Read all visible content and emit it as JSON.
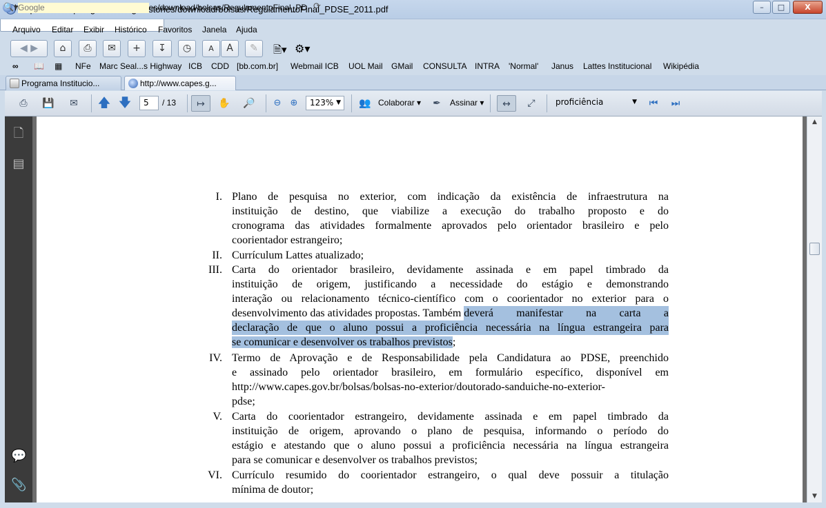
{
  "window": {
    "title": "http://www.capes.gov.br/images/stories/download/bolsas/RegulamentoFinal_PDSE_2011.pdf",
    "buttons": {
      "minimize": "–",
      "maximize": "□",
      "close": "X"
    }
  },
  "menu": [
    "Arquivo",
    "Editar",
    "Exibir",
    "Histórico",
    "Favoritos",
    "Janela",
    "Ajuda"
  ],
  "navbar": {
    "url": "http://www.capes.gov.br/images/stories/download/bolsas/RegulamentoFinal_PD",
    "search_placeholder": "Google"
  },
  "bookmarks": [
    "NFe",
    "Marc Seal...s Highway",
    "ICB",
    "CDD",
    "[bb.com.br]",
    "Webmail ICB",
    "UOL Mail",
    "GMail",
    "CONSULTA",
    "INTRA",
    "'Normal'",
    "Janus",
    "Lattes Institucional",
    "Wikipédia"
  ],
  "tabs": [
    {
      "label": "Programa Institucio..."
    },
    {
      "label": "http://www.capes.g..."
    }
  ],
  "pdf_toolbar": {
    "page_current": "5",
    "page_total": "/ 13",
    "zoom": "123%",
    "collaborate": "Colaborar",
    "sign": "Assinar",
    "find_text": "proficiência"
  },
  "document": {
    "items": [
      {
        "num": "I.",
        "lines": [
          "Plano de pesquisa no exterior, com indicação da existência de infraestrutura na",
          "instituição de destino, que viabilize a execução do trabalho proposto e do",
          "cronograma das atividades formalmente aprovados pelo orientador brasileiro e pelo",
          "coorientador estrangeiro;"
        ]
      },
      {
        "num": "II.",
        "lines": [
          "Currículum Lattes atualizado;"
        ]
      },
      {
        "num": "III.",
        "lines": [
          "Carta do orientador brasileiro, devidamente assinada e em papel timbrado da",
          "instituição de origem, justificando a necessidade do estágio e demonstrando",
          "interação ou relacionamento técnico-científico com o coorientador no exterior para o"
        ],
        "line4_pre": "desenvolvimento das atividades propostas. Também ",
        "line4_hl": "deverá manifestar na carta a",
        "line5_hl": "declaração de que o aluno possui a proficiência necessária na língua estrangeira para",
        "line6_hl": "se comunicar e desenvolver os trabalhos previstos",
        "line6_post": ";"
      },
      {
        "num": "IV.",
        "lines": [
          "Termo de Aprovação e de Responsabilidade pela Candidatura ao PDSE, preenchido",
          "e assinado pelo orientador brasileiro, em formulário específico, disponível em",
          "http://www.capes.gov.br/bolsas/bolsas-no-exterior/doutorado-sanduiche-no-exterior-",
          "pdse;"
        ]
      },
      {
        "num": "V.",
        "lines": [
          "Carta do coorientador estrangeiro, devidamente assinada e em papel timbrado da",
          "instituição de origem, aprovando o plano de pesquisa, informando o período do",
          "estágio e atestando que o aluno possui a proficiência necessária na língua estrangeira",
          "para se comunicar e desenvolver os trabalhos previstos;"
        ]
      },
      {
        "num": "VI.",
        "lines": [
          "Currículo resumido do coorientador estrangeiro, o qual deve possuir a titulação",
          "mínima de doutor;"
        ]
      }
    ]
  }
}
